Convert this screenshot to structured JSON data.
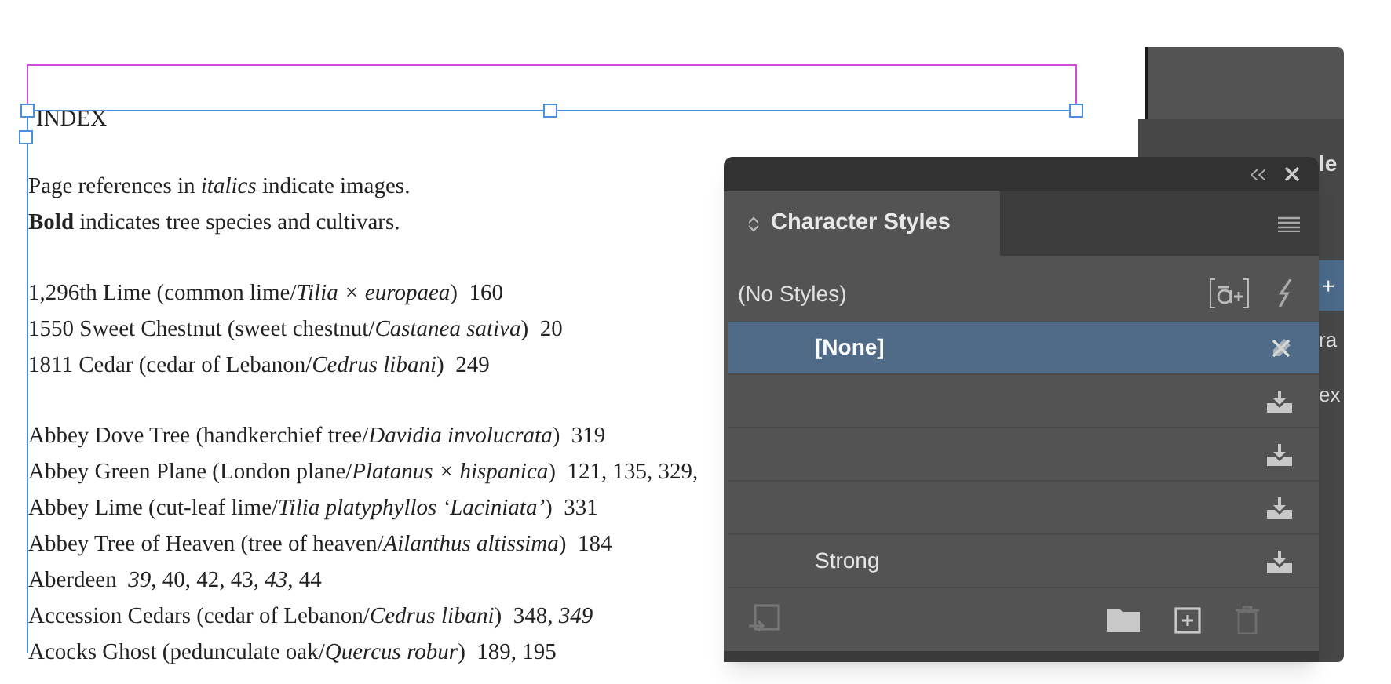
{
  "document": {
    "heading": "INDEX",
    "notes": [
      "Page references in *italics* indicate images.",
      "**Bold** indicates tree species and cultivars."
    ],
    "entry_groups": [
      [
        "1,296th Lime (common lime/*Tilia × europaea*)  160",
        "1550 Sweet Chestnut (sweet chestnut/*Castanea sativa*)  20",
        "1811 Cedar (cedar of Lebanon/*Cedrus libani*)  249"
      ],
      [
        "Abbey Dove Tree (handkerchief tree/*Davidia involucrata*)  319",
        "Abbey Green Plane (London plane/*Platanus × hispanica*)  121, 135, 329,",
        "Abbey Lime (cut-leaf lime/*Tilia platyphyllos ‘Laciniata’*)  331",
        "Abbey Tree of Heaven (tree of heaven/*Ailanthus altissima*)  184",
        "Aberdeen  *39*, 40, 42, 43, *43*, 44",
        "Accession Cedars (cedar of Lebanon/*Cedrus libani*)  348, *349*",
        "Acocks Ghost (pedunculate oak/*Quercus robur*)  189, 195"
      ]
    ]
  },
  "back_panel": {
    "texts": [
      "le",
      "+",
      "ra",
      "ex"
    ]
  },
  "panel": {
    "title": "Character Styles",
    "group": "(No Styles)",
    "rows": [
      {
        "label": "[None]",
        "kind": "none",
        "selected": true
      },
      {
        "kind": "imported",
        "selected": false
      },
      {
        "kind": "imported",
        "selected": false
      },
      {
        "kind": "imported",
        "selected": false
      },
      {
        "label": "Strong",
        "kind": "imported",
        "selected": false
      }
    ]
  }
}
